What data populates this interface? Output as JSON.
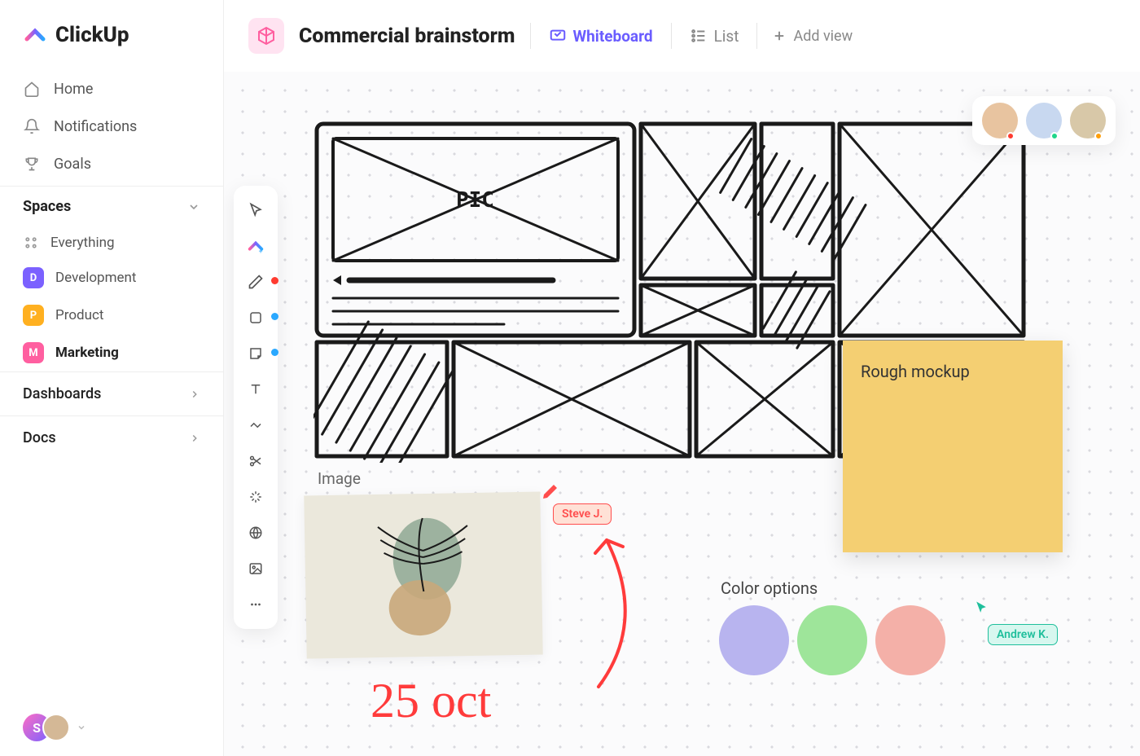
{
  "brand": "ClickUp",
  "nav": {
    "home": "Home",
    "notifications": "Notifications",
    "goals": "Goals"
  },
  "spaces": {
    "header": "Spaces",
    "everything": "Everything",
    "items": [
      {
        "letter": "D",
        "label": "Development",
        "color": "#7b61ff"
      },
      {
        "letter": "P",
        "label": "Product",
        "color": "#ffb020"
      },
      {
        "letter": "M",
        "label": "Marketing",
        "color": "#ff5fa0",
        "active": true
      }
    ]
  },
  "sections": {
    "dashboards": "Dashboards",
    "docs": "Docs"
  },
  "page": {
    "title": "Commercial brainstorm",
    "views": {
      "whiteboard": "Whiteboard",
      "list": "List",
      "add": "Add view"
    }
  },
  "toolbox_dots": {
    "pen": "#ff3b30",
    "shape": "#2aa8ff",
    "note": "#2aa8ff"
  },
  "collaborators": [
    {
      "bg": "#e8c4a0",
      "status": "#ff3b30"
    },
    {
      "bg": "#c8d8f0",
      "status": "#1fd68a"
    },
    {
      "bg": "#d8c8a8",
      "status": "#ff9f0a"
    }
  ],
  "sketch": {
    "pic_label": "PIC"
  },
  "sticky": {
    "text": "Rough mockup"
  },
  "image_block": {
    "label": "Image"
  },
  "handwriting": {
    "date": "25 oct"
  },
  "cursors": {
    "steve": {
      "name": "Steve J.",
      "color": "#ff4d4d",
      "bg": "#ffe1d6"
    },
    "andrew": {
      "name": "Andrew K.",
      "color": "#1fbf9c",
      "bg": "#d7f7ef"
    }
  },
  "color_options": {
    "label": "Color options",
    "swatches": [
      "#b8b4ef",
      "#9ee59a",
      "#f4b0a8"
    ]
  },
  "sidebar_user_initial": "S"
}
